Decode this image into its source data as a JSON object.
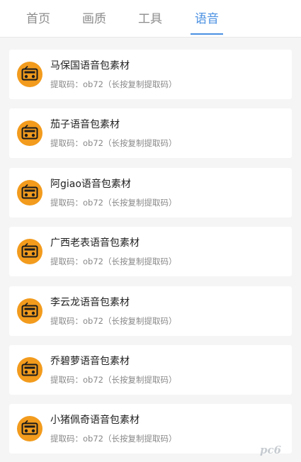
{
  "tabs": [
    {
      "label": "首页",
      "active": false
    },
    {
      "label": "画质",
      "active": false
    },
    {
      "label": "工具",
      "active": false
    },
    {
      "label": "语音",
      "active": true
    }
  ],
  "colors": {
    "accent": "#4a90e2",
    "icon_bg": "#f29b1d",
    "card_bg": "#ffffff",
    "page_bg": "#f5f5f5"
  },
  "items": [
    {
      "title": "马保国语音包素材",
      "code": "提取码：ob72（长按复制提取码）",
      "icon": "radio-icon"
    },
    {
      "title": "茄子语音包素材",
      "code": "提取码：ob72（长按复制提取码）",
      "icon": "radio-icon"
    },
    {
      "title": "阿giao语音包素材",
      "code": "提取码：ob72（长按复制提取码）",
      "icon": "radio-icon"
    },
    {
      "title": "广西老表语音包素材",
      "code": "提取码：ob72（长按复制提取码）",
      "icon": "radio-icon"
    },
    {
      "title": "李云龙语音包素材",
      "code": "提取码：ob72（长按复制提取码）",
      "icon": "radio-icon"
    },
    {
      "title": "乔碧萝语音包素材",
      "code": "提取码：ob72（长按复制提取码）",
      "icon": "radio-icon"
    },
    {
      "title": "小猪佩奇语音包素材",
      "code": "提取码：ob72（长按复制提取码）",
      "icon": "radio-icon"
    }
  ],
  "watermark": {
    "text": "pc6"
  }
}
